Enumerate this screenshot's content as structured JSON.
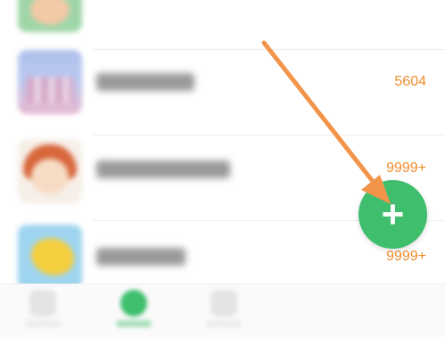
{
  "list": {
    "items": [
      {
        "title": "",
        "count": "",
        "thumb_icon": "cartoon-thumbnail"
      },
      {
        "title": "",
        "count": "5604",
        "thumb_icon": "book-cover-thumbnail"
      },
      {
        "title": "",
        "count": "9999+",
        "thumb_icon": "cartoon-girl-thumbnail"
      },
      {
        "title": "",
        "count": "9999+",
        "thumb_icon": "yellow-leaf-thumbnail"
      }
    ],
    "count_color": "#f08c2e"
  },
  "fab": {
    "label": "+",
    "color": "#3fbf6e"
  },
  "annotation": {
    "arrow_color": "#f2954b"
  },
  "bottom_nav": {
    "active_color": "#3fbf6e",
    "items": [
      {
        "icon": "nav-home-icon"
      },
      {
        "icon": "nav-discover-icon"
      },
      {
        "icon": "nav-profile-icon"
      }
    ]
  }
}
